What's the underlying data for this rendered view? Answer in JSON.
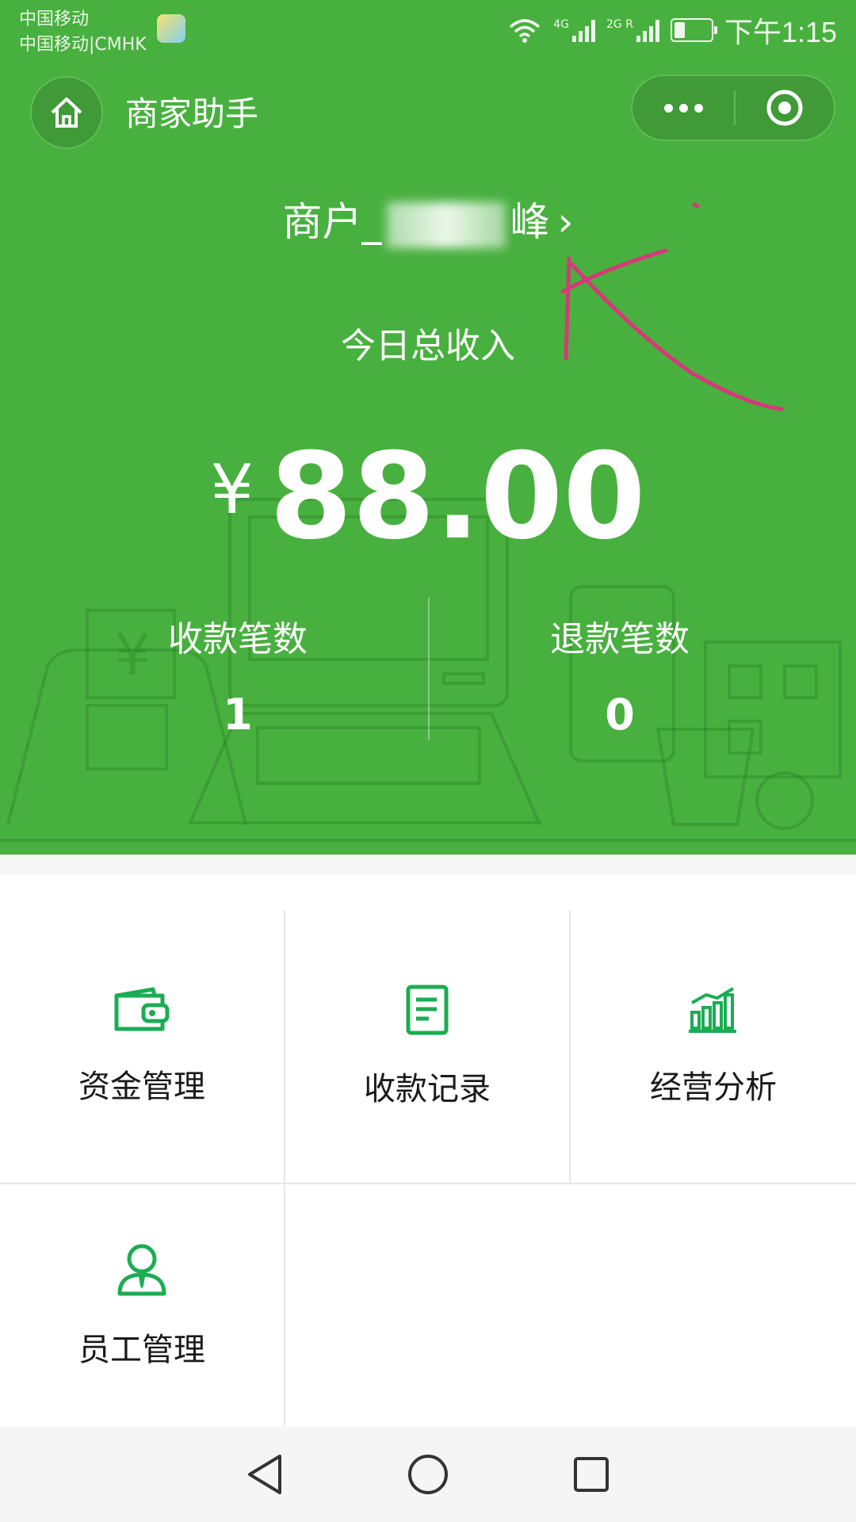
{
  "status_bar": {
    "carrier_line1": "中国移动",
    "carrier_line2": "中国移动|CMHK",
    "network_1": "4G",
    "network_2": "2G R",
    "battery_level": 0.3,
    "time": "下午1:15"
  },
  "nav": {
    "title": "商家助手",
    "home_icon": "home-icon",
    "more_icon": "more-dots-icon",
    "close_icon": "target-close-icon"
  },
  "merchant": {
    "prefix": "商户_",
    "name_visible_part": "峰",
    "chevron": "›"
  },
  "income": {
    "label": "今日总收入",
    "currency": "¥",
    "amount": "88.00"
  },
  "stats": {
    "receipts_label": "收款笔数",
    "receipts_count": "1",
    "refunds_label": "退款笔数",
    "refunds_count": "0"
  },
  "menu": [
    {
      "label": "资金管理",
      "icon": "wallet-icon"
    },
    {
      "label": "收款记录",
      "icon": "document-icon"
    },
    {
      "label": "经营分析",
      "icon": "bar-chart-icon"
    },
    {
      "label": "员工管理",
      "icon": "staff-icon"
    }
  ],
  "colors": {
    "header_green": "#48b03f",
    "icon_green": "#1aad52",
    "annotation_pink": "#d8387a"
  },
  "system_nav": {
    "back_icon": "back-triangle-icon",
    "home_icon": "home-circle-icon",
    "recents_icon": "recents-square-icon"
  }
}
